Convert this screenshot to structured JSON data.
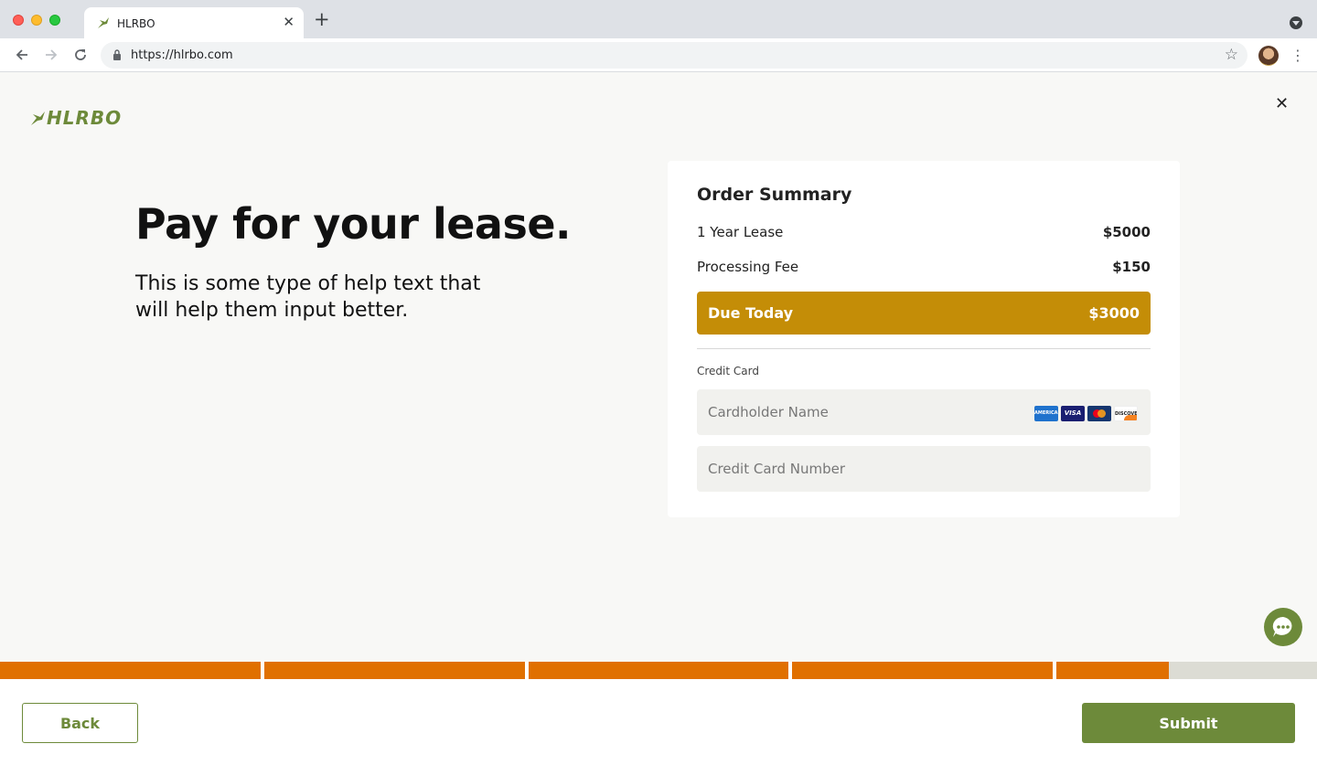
{
  "browser": {
    "tab_title": "HLRBO",
    "tab_close": "✕",
    "new_tab": "+",
    "url": "https://hlrbo.com",
    "star": "☆",
    "kebab": "⋮"
  },
  "page": {
    "logo_text": "HLRBO",
    "close": "✕",
    "headline": "Pay for your lease.",
    "help_text": "This is some type of help text that will help them input better."
  },
  "order_summary": {
    "title": "Order Summary",
    "lines": [
      {
        "label": "1 Year Lease",
        "amount": "$5000"
      },
      {
        "label": "Processing Fee",
        "amount": "$150"
      }
    ],
    "due_label": "Due Today",
    "due_amount": "$3000",
    "credit_card_label": "Credit Card",
    "cardholder_placeholder": "Cardholder Name",
    "card_number_placeholder": "Credit Card Number",
    "card_brands": [
      "AMERICAN EXPRESS",
      "VISA",
      "",
      "DISCOVER"
    ]
  },
  "progress": {
    "total_steps": 5,
    "completed_fraction": 0.8875,
    "fill_color": "#e07000",
    "empty_color": "#dcdcd4"
  },
  "footer": {
    "back_label": "Back",
    "submit_label": "Submit"
  },
  "colors": {
    "brand_green": "#6d8a3a",
    "due_gold": "#c48d07"
  }
}
